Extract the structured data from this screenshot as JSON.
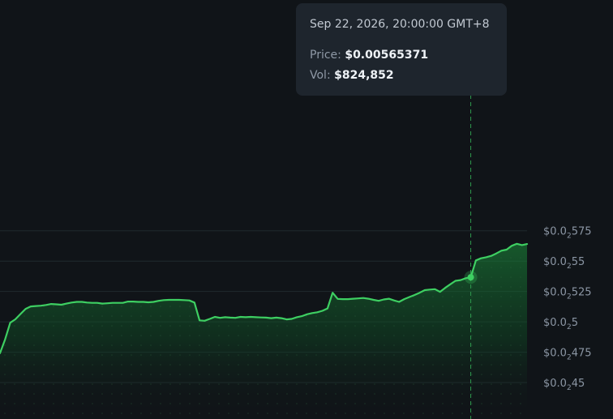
{
  "tooltip": {
    "date": "Sep 22, 2026, 20:00:00 GMT+8",
    "price_label": "Price:",
    "price_value": "$0.00565371",
    "vol_label": "Vol:",
    "vol_value": "$824,852"
  },
  "colors": {
    "background": "#101418",
    "line": "#3ecf62",
    "grid": "#1f2a2e",
    "axis_text": "#8b96a4",
    "tooltip_bg": "#1e252d"
  },
  "chart_data": {
    "type": "area",
    "ylim": [
      0.00542,
      0.005765
    ],
    "grid": true,
    "crosshair_index": 92,
    "y_ticks": [
      {
        "value": 0.005575,
        "prefix": "$0.0",
        "sub": "2",
        "suffix": "575"
      },
      {
        "value": 0.00555,
        "prefix": "$0.0",
        "sub": "2",
        "suffix": "55"
      },
      {
        "value": 0.005525,
        "prefix": "$0.0",
        "sub": "2",
        "suffix": "525"
      },
      {
        "value": 0.0055,
        "prefix": "$0.0",
        "sub": "2",
        "suffix": "5"
      },
      {
        "value": 0.005475,
        "prefix": "$0.0",
        "sub": "2",
        "suffix": "475"
      },
      {
        "value": 0.00545,
        "prefix": "$0.0",
        "sub": "2",
        "suffix": "45"
      }
    ],
    "values": [
      0.0054742,
      0.0054856,
      0.0054993,
      0.0055021,
      0.0055064,
      0.0055107,
      0.0055127,
      0.005513,
      0.0055133,
      0.0055139,
      0.0055147,
      0.0055144,
      0.0055141,
      0.005515,
      0.0055159,
      0.0055164,
      0.0055164,
      0.0055159,
      0.0055156,
      0.0055156,
      0.005515,
      0.0055153,
      0.0055156,
      0.0055156,
      0.0055156,
      0.0055167,
      0.0055167,
      0.0055164,
      0.0055164,
      0.0055161,
      0.0055164,
      0.0055173,
      0.0055179,
      0.0055181,
      0.0055181,
      0.0055181,
      0.0055179,
      0.0055176,
      0.0055159,
      0.0055012,
      0.0055009,
      0.0055024,
      0.0055041,
      0.0055033,
      0.0055038,
      0.0055035,
      0.0055033,
      0.0055041,
      0.0055038,
      0.0055041,
      0.0055038,
      0.0055036,
      0.0055035,
      0.005503,
      0.0055035,
      0.005503,
      0.005502,
      0.0055024,
      0.0055038,
      0.0055047,
      0.0055062,
      0.0055072,
      0.0055079,
      0.0055091,
      0.005511,
      0.005524,
      0.0055189,
      0.0055187,
      0.0055187,
      0.005519,
      0.0055193,
      0.0055196,
      0.005519,
      0.0055181,
      0.0055173,
      0.0055184,
      0.005519,
      0.0055176,
      0.0055164,
      0.0055187,
      0.0055204,
      0.0055221,
      0.005524,
      0.0055261,
      0.0055266,
      0.0055269,
      0.0055247,
      0.005528,
      0.0055309,
      0.0055338,
      0.0055344,
      0.0055359,
      0.0055367,
      0.0055506,
      0.0055523,
      0.0055532,
      0.0055543,
      0.0055563,
      0.0055586,
      0.0055595,
      0.0055626,
      0.0055643,
      0.0055632,
      0.0055641
    ]
  }
}
